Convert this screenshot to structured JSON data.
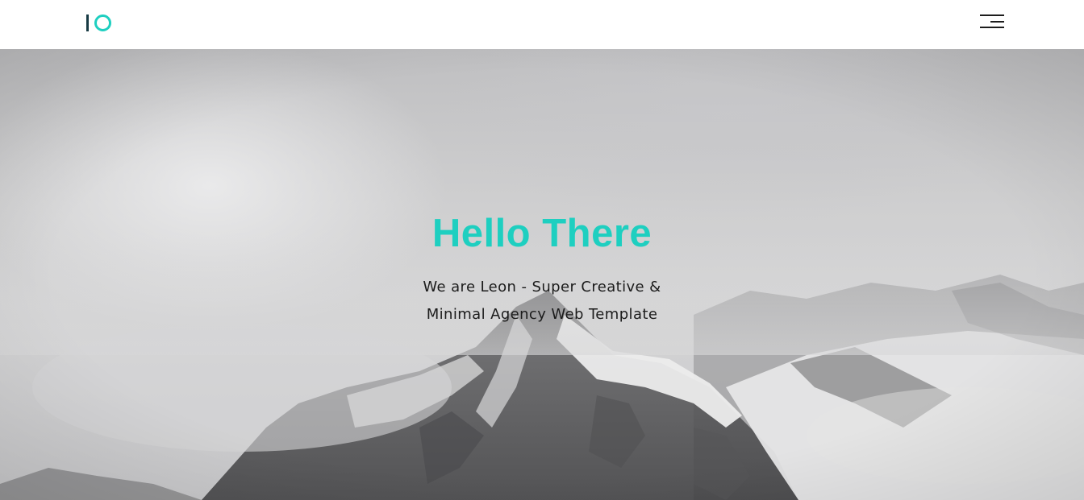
{
  "header": {
    "logo_icon": "io-logo-icon",
    "menu_icon": "hamburger-menu-icon"
  },
  "hero": {
    "title": "Hello There",
    "subtitle_line1": "We are Leon - Super Creative &",
    "subtitle_line2": "Minimal Agency Web Template",
    "background_image": "snowy-mountain-peaks-in-fog"
  },
  "colors": {
    "accent": "#1ecfc0",
    "logo_dark": "#173a44",
    "text": "#1b1b1b",
    "header_bg": "#ffffff"
  }
}
